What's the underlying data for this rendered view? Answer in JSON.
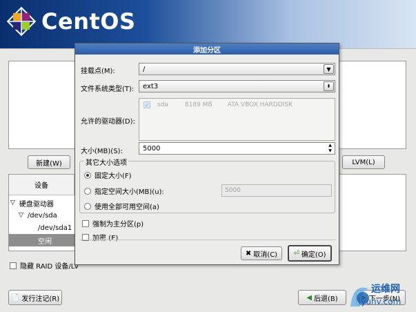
{
  "brand": {
    "name": "CentOS"
  },
  "background": {
    "new_button": "新建(W)",
    "lvm_button": "LVM(L)",
    "table_header_device": "设备",
    "tree": [
      "硬盘驱动器",
      "/dev/sda",
      "/dev/sda1",
      "空闲"
    ],
    "hide_raid_label": "隐藏 RAID 设备/LV",
    "release_notes_button": "发行注记(R)",
    "back_button": "后退(B)",
    "next_button": "下一步(N)"
  },
  "dialog": {
    "title": "添加分区",
    "mount_point_label": "挂载点(M):",
    "mount_point_value": "/",
    "fs_type_label": "文件系统类型(T):",
    "fs_type_value": "ext3",
    "drives_label": "允许的驱动器(D):",
    "drive": {
      "name": "sda",
      "size": "8189 MB",
      "model": "ATA VBOX HARDDISK"
    },
    "size_label": "大小(MB)(S):",
    "size_value": "5000",
    "options_title": "其它大小选项",
    "opt_fixed": "固定大小(F)",
    "opt_fill_upto": "指定空间大小(MB)(u):",
    "opt_fill_upto_value": "5000",
    "opt_fill_all": "使用全部可用空间(a)",
    "force_primary": "强制为主分区(p)",
    "encrypt": "加密 (E)",
    "cancel": "取消(C)",
    "ok": "确定(O)"
  },
  "watermark": {
    "line1": "运维网",
    "line2": "iyunv.com"
  },
  "colors": {
    "header_dark": "#0a2f6e",
    "dialog_title": "#2d5ea8",
    "selection": "#8d8d8d"
  }
}
